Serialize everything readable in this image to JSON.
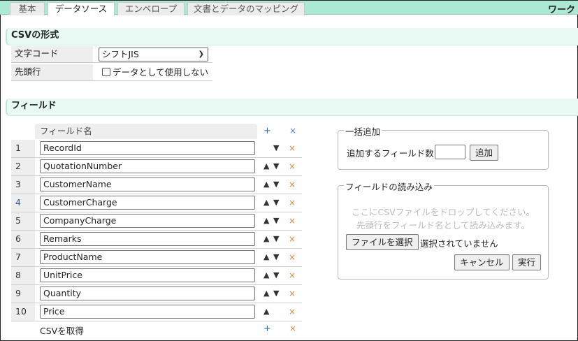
{
  "tabs": [
    {
      "label": "基本"
    },
    {
      "label": "データソース"
    },
    {
      "label": "エンベロープ"
    },
    {
      "label": "文書とデータのマッピング"
    }
  ],
  "window_title": "ワーク",
  "csv_format": {
    "title": "CSVの形式",
    "encoding_label": "文字コード",
    "encoding_value": "シフトJIS",
    "header_label": "先頭行",
    "header_checkbox": "データとして使用しない",
    "header_checked": false
  },
  "fields": {
    "title": "フィールド",
    "column_header": "フィールド名",
    "add_symbol": "+",
    "remove_symbol": "×",
    "up_symbol": "▲",
    "down_symbol": "▼",
    "rows": [
      {
        "num": "1",
        "name": "RecordId"
      },
      {
        "num": "2",
        "name": "QuotationNumber"
      },
      {
        "num": "3",
        "name": "CustomerName"
      },
      {
        "num": "4",
        "name": "CustomerCharge"
      },
      {
        "num": "5",
        "name": "CompanyCharge"
      },
      {
        "num": "6",
        "name": "Remarks"
      },
      {
        "num": "7",
        "name": "ProductName"
      },
      {
        "num": "8",
        "name": "UnitPrice"
      },
      {
        "num": "9",
        "name": "Quantity"
      },
      {
        "num": "10",
        "name": "Price"
      }
    ],
    "get_csv_link": "CSVを取得"
  },
  "bulk_add": {
    "legend": "一括追加",
    "label": "追加するフィールド数",
    "value": "",
    "button": "追加"
  },
  "import": {
    "legend": "フィールドの読み込み",
    "hint1": "ここにCSVファイルをドロップしてください。",
    "hint2": "先頭行をフィールド名として読み込みます。",
    "file_button": "ファイルを選択",
    "file_status": "選択されていません",
    "cancel": "キャンセル",
    "run": "実行"
  }
}
